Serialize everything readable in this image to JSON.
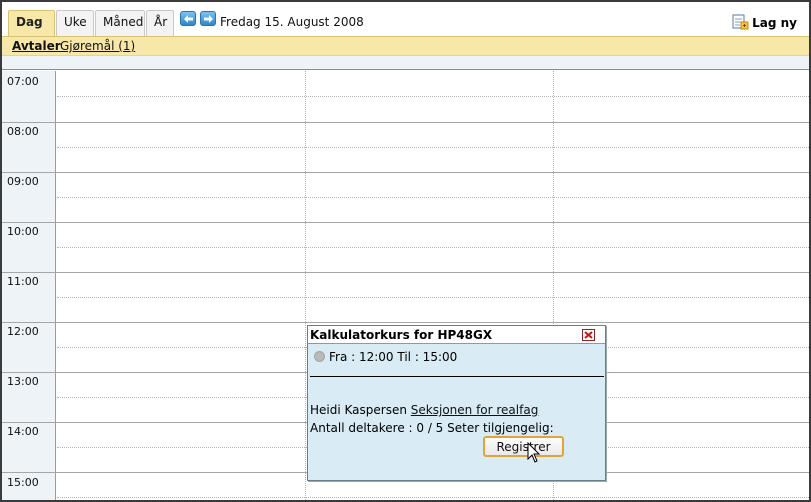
{
  "tabs": [
    {
      "label": "Dag",
      "active": true
    },
    {
      "label": "Uke",
      "active": false
    },
    {
      "label": "Måned",
      "active": false
    },
    {
      "label": "År",
      "active": false
    }
  ],
  "nav": {
    "prev_icon": "arrow-left-icon",
    "next_icon": "arrow-right-icon"
  },
  "current_date": "Fredag 15. August 2008",
  "new_button": {
    "label": "Lag ny",
    "icon": "new-entry-icon"
  },
  "subtabs": [
    {
      "label": "Avtaler",
      "active": true
    },
    {
      "label": "Gjøremål (1)",
      "active": false
    }
  ],
  "hours": [
    "07:00",
    "08:00",
    "09:00",
    "10:00",
    "11:00",
    "12:00",
    "13:00",
    "14:00",
    "15:00"
  ],
  "popup": {
    "title": "Kalkulatorkurs for HP48GX",
    "time_text": "Fra : 12:00 Til : 15:00",
    "owner_name": "Heidi Kaspersen",
    "owner_link": "Seksjonen for realfag",
    "participants_text": "Antall deltakere : 0 / 5 Seter tilgjengelig:",
    "register_label": "Registrer"
  },
  "colors": {
    "accent": "#f7e7a8",
    "popup_bg": "#d9ebf4",
    "time_col_bg": "#eef3f7",
    "button_border": "#e2a43a"
  }
}
